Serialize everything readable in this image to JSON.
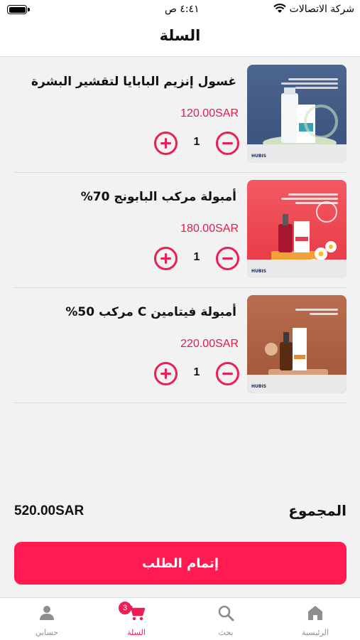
{
  "status_bar": {
    "time": "٤:٤١ ص",
    "carrier": "شركة الاتصالات"
  },
  "header": {
    "title": "السلة"
  },
  "cart": {
    "items": [
      {
        "name": "غسول إنزيم البابايا لتقشير البشرة",
        "price": "120.00SAR",
        "quantity": "1",
        "image": "papaya-cleanser-image",
        "image_text": "غسول إنزيم البابايا لتقشير البشرة",
        "brand": "HUBIS",
        "bg_color": "#49648f"
      },
      {
        "name": "أمبولة مركب البابونج 70%",
        "price": "180.00SAR",
        "quantity": "1",
        "image": "chamomile-ampoule-image",
        "image_text": "أمبولة مركب البابونج لبشرة متألقة ونضرة",
        "brand": "HUBIS",
        "bg_color": "#f04a55"
      },
      {
        "name": "أمبولة فيتامين C مركب 50%",
        "price": "220.00SAR",
        "quantity": "1",
        "image": "vitamin-c-ampoule-image",
        "image_text": "أمبولة فيتامين C",
        "brand": "HUBIS",
        "bg_color": "#b0654a"
      }
    ]
  },
  "summary": {
    "total_label": "المجموع",
    "total_amount": "520.00SAR"
  },
  "checkout": {
    "label": "إتمام الطلب"
  },
  "tab_bar": {
    "home": "الرئيسية",
    "search": "بحث",
    "cart": "السلة",
    "account": "حسابي",
    "cart_badge": "3"
  },
  "colors": {
    "accent": "#ee1d52",
    "button": "#ff1b52",
    "inactive": "#8e8e8e"
  }
}
